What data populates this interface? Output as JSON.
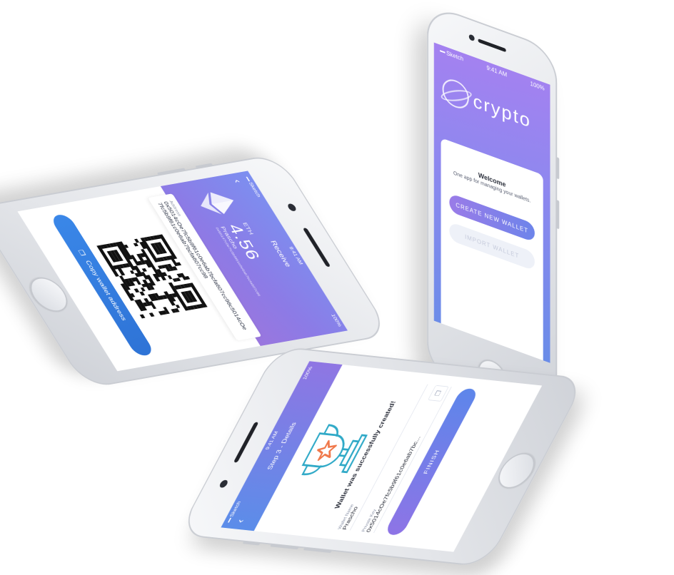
{
  "colors": {
    "accent_blue": "#3a87e8",
    "accent_purple": "#9a7be8",
    "background": "#ffffff"
  },
  "status_bar": {
    "carrier": "Sketch",
    "time": "9:41 AM",
    "battery": "100%"
  },
  "receive_screen": {
    "title": "Receive",
    "back_icon": "chevron-left-icon",
    "coin_symbol": "ETH",
    "amount": "4.56",
    "wallet_name": "Prascho",
    "short_address": "0x50147c0e7fc5b9f61e0e6ab7bcfa607c98",
    "address_label": "Address",
    "address_value": "0x5014cOe7fc5b9f61c0e6ab7bcfa607cc98c5014cOe7fc5b9f61c0e6ab7bcfa607cc98",
    "copy_button": "Copy wallet address",
    "copy_icon": "copy-icon"
  },
  "welcome_screen": {
    "logo_text": "crypto",
    "title": "Welcome",
    "subtitle": "One app for managing your wallets.",
    "create_button": "CREATE NEW WALLET",
    "import_button": "IMPORT WALLET"
  },
  "details_screen": {
    "title": "Step 3 - Details",
    "back_icon": "chevron-left-icon",
    "trophy_icon": "trophy-icon",
    "success_message": "Wallet was successfully created!",
    "wallet_name_label": "Wallet Name",
    "wallet_name_value": "Prascho",
    "private_key_label": "Private Key",
    "private_key_value": "0x5014cOe7fc5b9f61c0e6ab7bc...",
    "finish_button": "FINISH"
  }
}
